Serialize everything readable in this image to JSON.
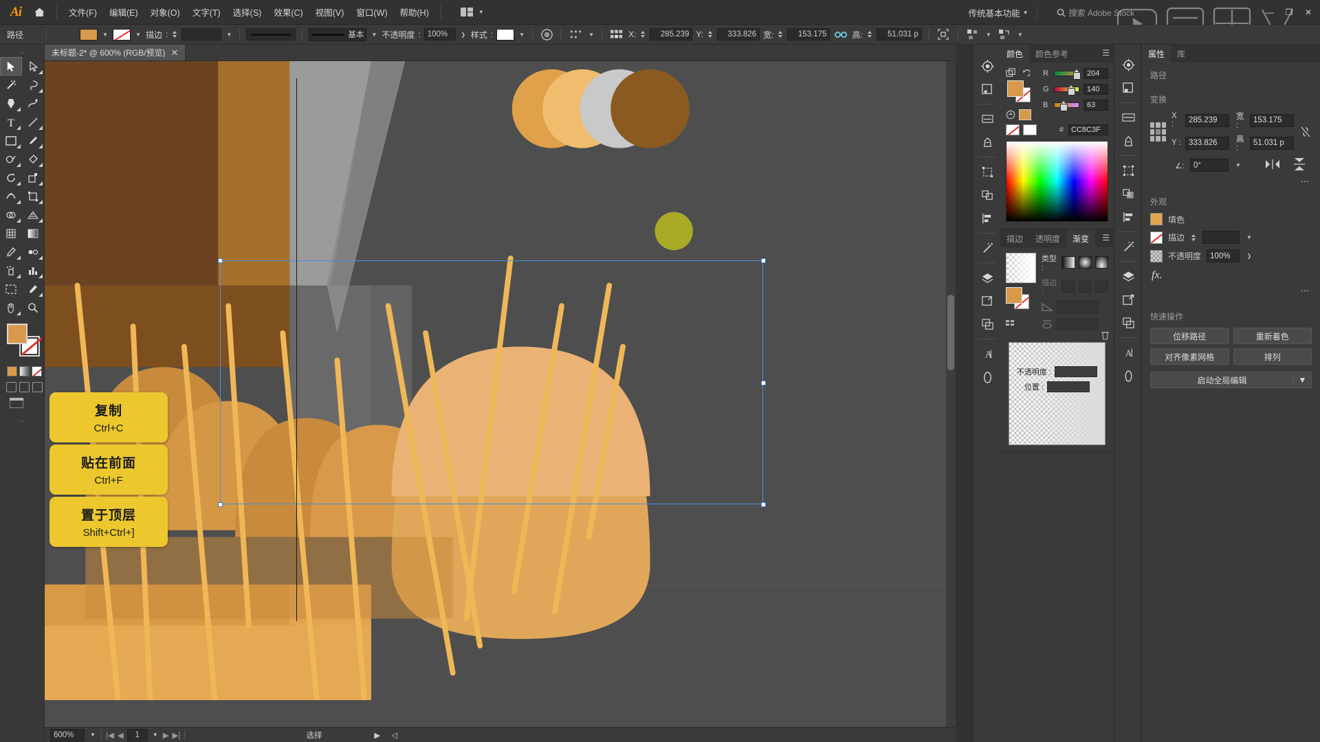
{
  "app": {
    "name": "Ai",
    "logo_icon": "illustrator-logo",
    "home_icon": "home-icon"
  },
  "menubar": {
    "items": [
      {
        "label": "文件(F)",
        "name": "menu-file"
      },
      {
        "label": "编辑(E)",
        "name": "menu-edit"
      },
      {
        "label": "对象(O)",
        "name": "menu-object"
      },
      {
        "label": "文字(T)",
        "name": "menu-type"
      },
      {
        "label": "选择(S)",
        "name": "menu-select"
      },
      {
        "label": "效果(C)",
        "name": "menu-effect"
      },
      {
        "label": "视图(V)",
        "name": "menu-view"
      },
      {
        "label": "窗口(W)",
        "name": "menu-window"
      },
      {
        "label": "帮助(H)",
        "name": "menu-help"
      }
    ],
    "arrange_icon": "arrange-documents-icon",
    "workspace": "传统基本功能",
    "search_placeholder": "搜索 Adobe Stock",
    "search_icon": "search-icon",
    "minimize": "—",
    "maximize": "❐",
    "close": "✕"
  },
  "controlbar": {
    "doc_label": "路径",
    "fill_color": "#d89a4a",
    "stroke_label": "描边",
    "stroke_weight": "",
    "stroke_profile_label": "基本",
    "opacity_label": "不透明度",
    "opacity_value": "100%",
    "style_label": "样式",
    "transform_x_label": "X:",
    "transform_x_value": "285.239",
    "transform_y_label": "Y:",
    "transform_y_value": "333.826",
    "width_label": "宽:",
    "width_value": "153.175",
    "height_label": "高:",
    "height_value": "51.031 p",
    "link_icon": "link-chain-icon",
    "align_icon": "align-icon",
    "anchor_icon": "anchor-point-icon"
  },
  "toolbar": {
    "grip_icon": "panel-grip-icon",
    "tools": [
      {
        "name": "selection-tool",
        "glyph": "selection",
        "selected": true
      },
      {
        "name": "direct-selection-tool",
        "glyph": "direct-selection"
      },
      {
        "name": "magic-wand-tool",
        "glyph": "magic-wand"
      },
      {
        "name": "lasso-tool",
        "glyph": "lasso"
      },
      {
        "name": "pen-tool",
        "glyph": "pen"
      },
      {
        "name": "curvature-tool",
        "glyph": "curvature"
      },
      {
        "name": "type-tool",
        "glyph": "type"
      },
      {
        "name": "line-segment-tool",
        "glyph": "line"
      },
      {
        "name": "rectangle-tool",
        "glyph": "rectangle"
      },
      {
        "name": "paintbrush-tool",
        "glyph": "paintbrush"
      },
      {
        "name": "shaper-tool",
        "glyph": "shaper"
      },
      {
        "name": "eraser-tool",
        "glyph": "eraser"
      },
      {
        "name": "rotate-tool",
        "glyph": "rotate"
      },
      {
        "name": "scale-tool",
        "glyph": "scale"
      },
      {
        "name": "width-tool",
        "glyph": "width"
      },
      {
        "name": "free-transform-tool",
        "glyph": "free-transform"
      },
      {
        "name": "shape-builder-tool",
        "glyph": "shape-builder"
      },
      {
        "name": "perspective-grid-tool",
        "glyph": "perspective"
      },
      {
        "name": "mesh-tool",
        "glyph": "mesh"
      },
      {
        "name": "gradient-tool",
        "glyph": "gradient"
      },
      {
        "name": "eyedropper-tool",
        "glyph": "eyedropper"
      },
      {
        "name": "blend-tool",
        "glyph": "blend"
      },
      {
        "name": "symbol-sprayer-tool",
        "glyph": "symbol-sprayer"
      },
      {
        "name": "column-graph-tool",
        "glyph": "column-graph"
      },
      {
        "name": "artboard-tool",
        "glyph": "artboard"
      },
      {
        "name": "slice-tool",
        "glyph": "slice"
      },
      {
        "name": "hand-tool",
        "glyph": "hand"
      },
      {
        "name": "zoom-tool",
        "glyph": "zoom"
      }
    ],
    "fill_color": "#d89a4a",
    "stroke_color": "none",
    "more_icon": "more-tools-icon"
  },
  "document": {
    "tab_title": "未标题-2* @ 600% (RGB/预览)",
    "close_icon": "close-tab-icon"
  },
  "statusbar": {
    "zoom": "600%",
    "artboard_number": "1",
    "tool_status": "选择",
    "first_icon": "first-artboard-icon",
    "prev_icon": "prev-artboard-icon",
    "next_icon": "next-artboard-icon",
    "last_icon": "last-artboard-icon",
    "play_icon": "play-icon",
    "back_icon": "back-icon"
  },
  "callouts": [
    {
      "title": "复制",
      "shortcut": "Ctrl+C",
      "name": "callout-copy"
    },
    {
      "title": "贴在前面",
      "shortcut": "Ctrl+F",
      "name": "callout-paste-in-front"
    },
    {
      "title": "置于顶层",
      "shortcut": "Shift+Ctrl+]",
      "name": "callout-bring-to-front"
    }
  ],
  "color_panel": {
    "tabs": [
      {
        "label": "颜色",
        "active": true,
        "name": "tab-color"
      },
      {
        "label": "颜色参考",
        "active": false,
        "name": "tab-color-guide"
      }
    ],
    "menu_icon": "panel-menu-icon",
    "channels": [
      {
        "label": "R",
        "value": "204",
        "pos": 80
      },
      {
        "label": "G",
        "value": "140",
        "pos": 55
      },
      {
        "label": "B",
        "value": "63",
        "pos": 25
      }
    ],
    "hex_symbol": "#",
    "hex_value": "CC8C3F",
    "fill_color": "#cc8c3f"
  },
  "gradient_panel": {
    "tabs": [
      {
        "label": "描边",
        "active": false,
        "name": "tab-stroke"
      },
      {
        "label": "透明度",
        "active": false,
        "name": "tab-transparency"
      },
      {
        "label": "渐变",
        "active": true,
        "name": "tab-gradient"
      }
    ],
    "menu_icon": "panel-menu-icon",
    "type_label": "类型 :",
    "stroke_label": "描边 :",
    "angle_label": "角度",
    "angle_value": "",
    "aspect_label": "长宽比",
    "aspect_value": "",
    "opacity_label": "不透明度 :",
    "opacity_value": "",
    "location_label": "位置 :",
    "location_value": "",
    "delete_icon": "delete-stop-icon"
  },
  "properties_panel": {
    "tabs": [
      {
        "label": "属性",
        "active": true,
        "name": "tab-properties"
      },
      {
        "label": "库",
        "active": false,
        "name": "tab-libraries"
      }
    ],
    "object_type": "路径",
    "transform_title": "变换",
    "x_label": "X :",
    "x_value": "285.239",
    "y_label": "Y :",
    "y_value": "333.826",
    "w_label": "宽 :",
    "w_value": "153.175",
    "h_label": "高 :",
    "h_value": "51.031 p",
    "angle_label": "∠:",
    "angle_value": "0°",
    "link_icon": "unlink-icon",
    "flip_h_icon": "flip-horizontal-icon",
    "flip_v_icon": "flip-vertical-icon",
    "more_icon": "more-options-icon",
    "appearance_title": "外观",
    "fill_label": "填色",
    "stroke_label": "描边",
    "stroke_weight": "",
    "opacity_label": "不透明度",
    "opacity_value": "100%",
    "fx_label": "fx.",
    "quick_actions_title": "快速操作",
    "quick_actions": [
      {
        "label": "位移路径",
        "name": "qa-offset-path"
      },
      {
        "label": "重新着色",
        "name": "qa-recolor"
      },
      {
        "label": "对齐像素网格",
        "name": "qa-align-pixel-grid"
      },
      {
        "label": "排列",
        "name": "qa-arrange"
      }
    ],
    "global_edit_label": "启动全局编辑",
    "fill_color": "#e3a452"
  },
  "rail_left": {
    "icons": [
      {
        "name": "color-wheel-icon"
      },
      {
        "name": "swatches-icon"
      }
    ]
  },
  "rail_right": {
    "icons": [
      {
        "name": "brushes-icon"
      },
      {
        "name": "symbols-icon"
      },
      {
        "name": "transform-icon"
      },
      {
        "name": "pathfinder-icon"
      },
      {
        "name": "align-panel-icon"
      },
      {
        "name": "magic-wand-panel-icon"
      },
      {
        "name": "layers-icon"
      },
      {
        "name": "artboards-icon"
      },
      {
        "name": "asset-export-icon"
      },
      {
        "name": "character-icon"
      },
      {
        "name": "ellipse-panel-icon"
      }
    ]
  },
  "colors": {
    "app_bg": "#323232",
    "panel_bg": "#3a3a3a",
    "canvas_bg": "#4e4e4e",
    "accent_orange": "#d89a4a",
    "callout_yellow": "#ecc82e",
    "selection_blue": "#4a8fe0"
  }
}
